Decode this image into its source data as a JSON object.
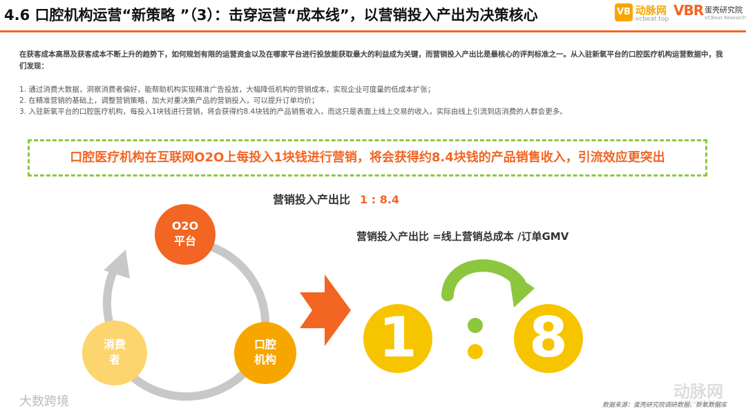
{
  "header": {
    "title": "4.6 口腔机构运营“新策略 ”（3）：击穿运营“成本线”，以营销投入产出为决策核心",
    "logo_vb_mark": "VB",
    "logo_vb_name": "动脉网",
    "logo_vb_url": "vcbeat.top",
    "logo_vbr_mark": "VBR",
    "logo_vbr_name": "蛋壳研究院",
    "logo_vbr_sub": "VCBeat Research",
    "accent_color": "#f26522"
  },
  "intro": "在获客成本高昂及获客成本不断上升的趋势下，如何规划有限的运营资金以及在哪家平台进行投放能获取最大的利益成为关键，而营销投入产出比是最核心的评判标准之一。从入驻新氧平台的口腔医疗机构运营数据中，我们发现：",
  "points": [
    "1.  通过消费大数据，洞察消费者偏好，能帮助机构实现精准广告投放，大幅降低机构的营销成本，实现企业可度量的低成本扩张；",
    "2.  在精准营销的基础上，调整营销策略，加大对重决策产品的营销投入，可以提升订单均价；",
    "3.  入驻新氧平台的口腔医疗机构，每投入1块钱进行营销，将会获得约8.4块钱的产品销售收入，而这只是表面上线上交易的收入，实际由线上引流到店消费的人群会更多。"
  ],
  "highlight": "口腔医疗机构在互联网O2O上每投入1块钱进行营销，将会获得约8.4块钱的产品销售收入，引流效应更突出",
  "ratio": {
    "title": "营销投入产出比",
    "value": "1 : 8.4",
    "formula": "营销投入产出比 =线上营销总成本 /订单GMV",
    "left_digit": "1",
    "colon": ":",
    "right_digit": "8"
  },
  "cycle": {
    "top": [
      "O2O",
      "平台"
    ],
    "right": [
      "口腔",
      "机构"
    ],
    "left": [
      "消费",
      "者"
    ],
    "colors": {
      "top": "#f26522",
      "right": "#f7a600",
      "left": "#fcd56e",
      "ring": "#c8c8c8"
    }
  },
  "footer": {
    "watermark_left": "大数跨境",
    "source": "数据来源：蛋壳研究院调研数据、新氧数据库",
    "watermark_right": "动脉网",
    "watermark_right_url": "vcbeat.top"
  }
}
